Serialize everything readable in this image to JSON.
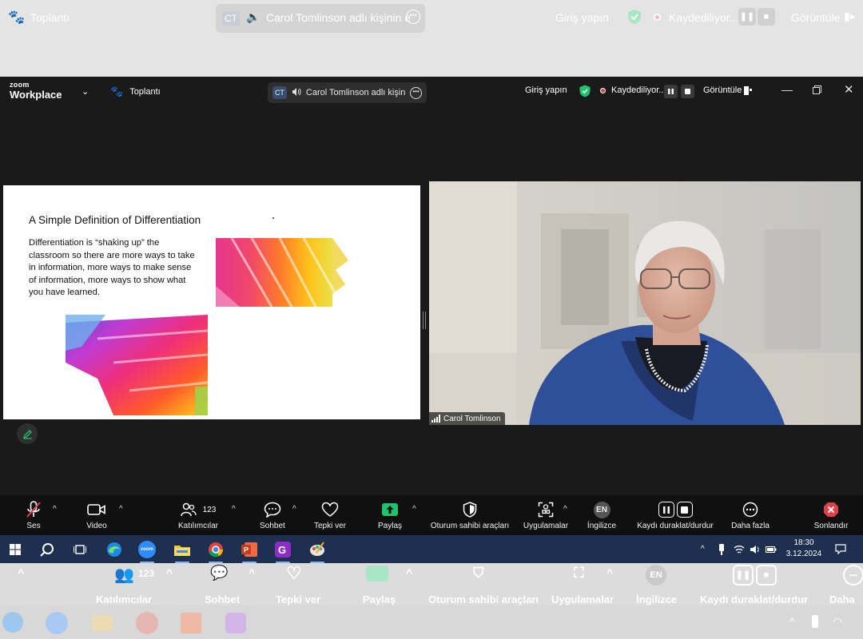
{
  "ghost_header": {
    "meeting_label": "Toplantı",
    "speaker_badge": "CT",
    "speaker_text": "Carol Tomlinson adlı kişinin e",
    "signin": "Giriş yapın",
    "recording": "Kaydediliyor...",
    "view": "Görüntüle"
  },
  "titlebar": {
    "brand_top": "zoom",
    "brand_bottom": "Workplace",
    "meeting_label": "Toplantı",
    "speaker_badge": "CT",
    "speaker_text": "Carol Tomlinson adlı kişinin e",
    "signin": "Giriş yapın",
    "recording": "Kaydediliyor...",
    "view": "Görüntüle"
  },
  "slide": {
    "title": "A Simple Definition of Differentiation",
    "body": "Differentiation is “shaking up” the classroom so there are more ways to take in information, more ways to make sense of information, more ways to show what you have learned."
  },
  "participant": {
    "name": "Carol Tomlinson"
  },
  "toolbar": {
    "audio": "Ses",
    "video": "Video",
    "participants": "Katılımcılar",
    "participants_count": "123",
    "chat": "Sohbet",
    "react": "Tepki ver",
    "share": "Paylaş",
    "host_tools": "Oturum sahibi araçları",
    "apps": "Uygulamalar",
    "language_badge": "EN",
    "language": "İngilizce",
    "recording_control": "Kaydı duraklat/durdur",
    "more": "Daha fazla",
    "end": "Sonlandır"
  },
  "ghost_toolbar": {
    "participants": "Katılımcılar",
    "participants_count": "123",
    "chat": "Sohbet",
    "react": "Tepki ver",
    "share": "Paylaş",
    "host_tools": "Oturum sahibi araçları",
    "apps": "Uygulamalar",
    "language_badge": "EN",
    "language": "İngilizce",
    "recording_control": "Kaydı duraklat/durdur",
    "more": "Daha fa"
  },
  "taskbar": {
    "zoom_label": "zoom",
    "time": "18:30",
    "date": "3.12.2024"
  },
  "colors": {
    "zoom_bg": "#1a1a1a",
    "share_green": "#21c16b",
    "end_red": "#e0424a",
    "taskbar": "#1e2f4f"
  }
}
